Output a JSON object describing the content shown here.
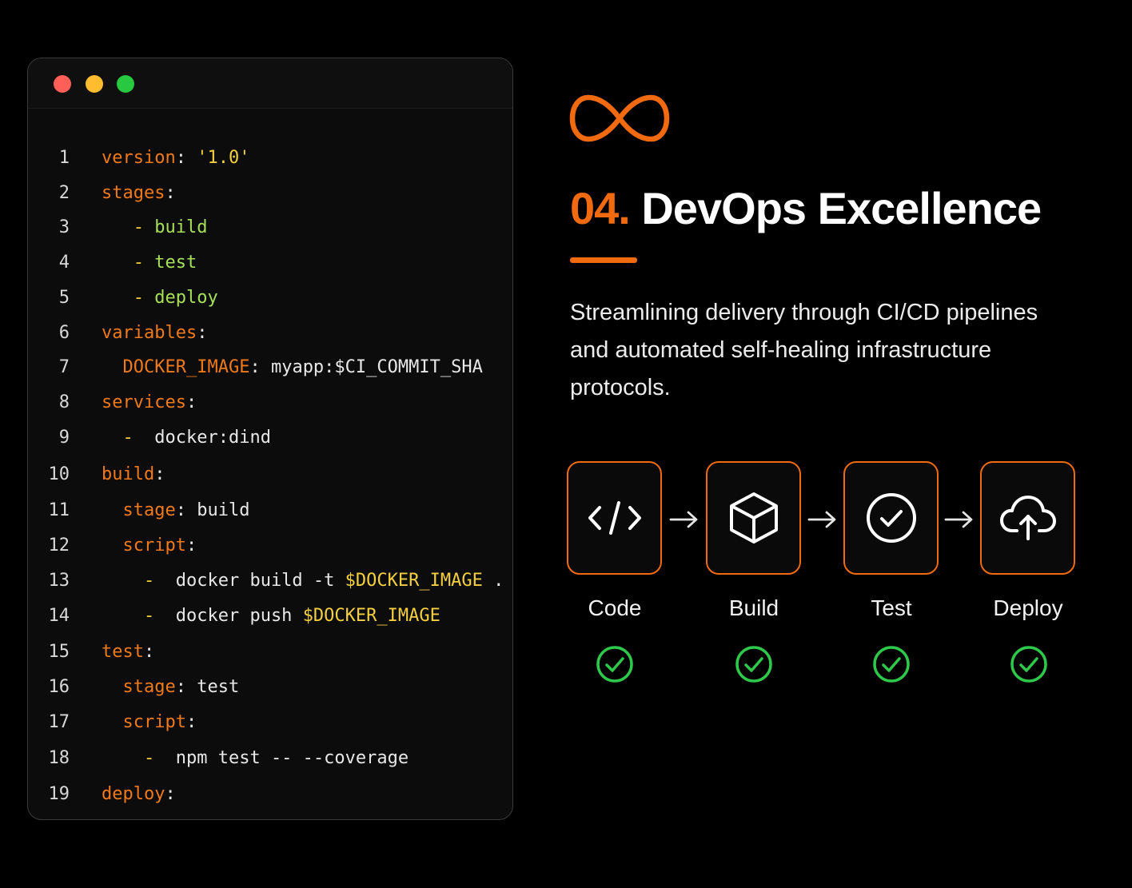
{
  "code": {
    "lines": [
      {
        "n": "1",
        "parts": [
          [
            "k",
            "version"
          ],
          [
            "p",
            ": "
          ],
          [
            "s",
            "'1.0'"
          ]
        ]
      },
      {
        "n": "2",
        "parts": [
          [
            "k",
            "stages"
          ],
          [
            "p",
            ":"
          ]
        ]
      },
      {
        "n": "3",
        "parts": [
          [
            "p",
            "   "
          ],
          [
            "d",
            "- "
          ],
          [
            "g",
            "build"
          ]
        ]
      },
      {
        "n": "4",
        "parts": [
          [
            "p",
            "   "
          ],
          [
            "d",
            "- "
          ],
          [
            "g",
            "test"
          ]
        ]
      },
      {
        "n": "5",
        "parts": [
          [
            "p",
            "   "
          ],
          [
            "d",
            "- "
          ],
          [
            "g",
            "deploy"
          ]
        ]
      },
      {
        "n": "6",
        "parts": [
          [
            "k",
            "variables"
          ],
          [
            "p",
            ":"
          ]
        ]
      },
      {
        "n": "7",
        "parts": [
          [
            "p",
            "  "
          ],
          [
            "k",
            "DOCKER_IMAGE"
          ],
          [
            "p",
            ": "
          ],
          [
            "w",
            "myapp:$CI_COMMIT_SHA"
          ]
        ]
      },
      {
        "n": "8",
        "parts": [
          [
            "k",
            "services"
          ],
          [
            "p",
            ":"
          ]
        ]
      },
      {
        "n": "9",
        "parts": [
          [
            "p",
            "  "
          ],
          [
            "d",
            "-  "
          ],
          [
            "w",
            "docker:dind"
          ]
        ]
      },
      {
        "n": "10",
        "parts": [
          [
            "k",
            "build"
          ],
          [
            "p",
            ":"
          ]
        ]
      },
      {
        "n": "11",
        "parts": [
          [
            "p",
            "  "
          ],
          [
            "k",
            "stage"
          ],
          [
            "p",
            ": "
          ],
          [
            "w",
            "build"
          ]
        ]
      },
      {
        "n": "12",
        "parts": [
          [
            "p",
            "  "
          ],
          [
            "k",
            "script"
          ],
          [
            "p",
            ":"
          ]
        ]
      },
      {
        "n": "13",
        "parts": [
          [
            "p",
            "    "
          ],
          [
            "d",
            "-  "
          ],
          [
            "w",
            "docker build -t "
          ],
          [
            "v",
            "$DOCKER_IMAGE"
          ],
          [
            "w",
            " ."
          ]
        ]
      },
      {
        "n": "14",
        "parts": [
          [
            "p",
            "    "
          ],
          [
            "d",
            "-  "
          ],
          [
            "w",
            "docker push "
          ],
          [
            "v",
            "$DOCKER_IMAGE"
          ]
        ]
      },
      {
        "n": "15",
        "parts": [
          [
            "k",
            "test"
          ],
          [
            "p",
            ":"
          ]
        ]
      },
      {
        "n": "16",
        "parts": [
          [
            "p",
            "  "
          ],
          [
            "k",
            "stage"
          ],
          [
            "p",
            ": "
          ],
          [
            "w",
            "test"
          ]
        ]
      },
      {
        "n": "17",
        "parts": [
          [
            "p",
            "  "
          ],
          [
            "k",
            "script"
          ],
          [
            "p",
            ":"
          ]
        ]
      },
      {
        "n": "18",
        "parts": [
          [
            "p",
            "    "
          ],
          [
            "d",
            "-  "
          ],
          [
            "w",
            "npm test -- --coverage"
          ]
        ]
      },
      {
        "n": "19",
        "parts": [
          [
            "k",
            "deploy"
          ],
          [
            "p",
            ":"
          ]
        ]
      }
    ]
  },
  "hero": {
    "icon": "infinity-icon",
    "number": "04.",
    "title": "DevOps Excellence",
    "description": "Streamlining delivery through CI/CD pipelines and automated self-healing infrastructure protocols."
  },
  "pipeline": {
    "steps": [
      {
        "label": "Code",
        "icon": "code-icon",
        "status": "check-circle-icon"
      },
      {
        "label": "Build",
        "icon": "cube-icon",
        "status": "check-circle-icon"
      },
      {
        "label": "Test",
        "icon": "check-circle-icon",
        "status": "check-circle-icon"
      },
      {
        "label": "Deploy",
        "icon": "cloud-upload-icon",
        "status": "check-circle-icon"
      }
    ]
  },
  "colors": {
    "accent": "#f26a10",
    "success": "#2ec84a"
  }
}
